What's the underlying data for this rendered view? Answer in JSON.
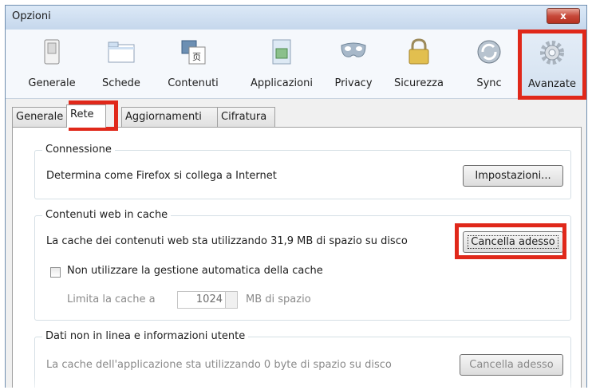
{
  "window": {
    "title": "Opzioni",
    "close_label": "x"
  },
  "toolbar": {
    "items": [
      {
        "label": "Generale",
        "icon": "switch-icon"
      },
      {
        "label": "Schede",
        "icon": "tabs-icon"
      },
      {
        "label": "Contenuti",
        "icon": "content-icon"
      },
      {
        "label": "Applicazioni",
        "icon": "applications-icon"
      },
      {
        "label": "Privacy",
        "icon": "mask-icon"
      },
      {
        "label": "Sicurezza",
        "icon": "lock-icon"
      },
      {
        "label": "Sync",
        "icon": "sync-icon"
      },
      {
        "label": "Avanzate",
        "icon": "gear-icon",
        "selected": true
      }
    ]
  },
  "tabs": [
    {
      "label": "Generale"
    },
    {
      "label": "Rete",
      "active": true
    },
    {
      "label": "Aggiornamenti"
    },
    {
      "label": "Cifratura"
    }
  ],
  "connection": {
    "title": "Connessione",
    "description": "Determina come Firefox si collega a Internet",
    "button": "Impostazioni..."
  },
  "cache": {
    "title": "Contenuti web in cache",
    "description": "La cache dei contenuti web sta utilizzando 31,9 MB di spazio su disco",
    "button": "Cancella adesso",
    "override_label": "Non utilizzare la gestione automatica della cache",
    "override_checked": false,
    "limit_label": "Limita la cache a",
    "limit_value": "1024",
    "limit_unit": "MB di spazio"
  },
  "offline": {
    "title": "Dati non in linea e informazioni utente",
    "description": "La cache dell'applicazione sta utilizzando 0 byte di spazio su disco",
    "button": "Cancella adesso"
  },
  "colors": {
    "highlight": "#e0281a",
    "title_bar": "#c5d7ec"
  }
}
